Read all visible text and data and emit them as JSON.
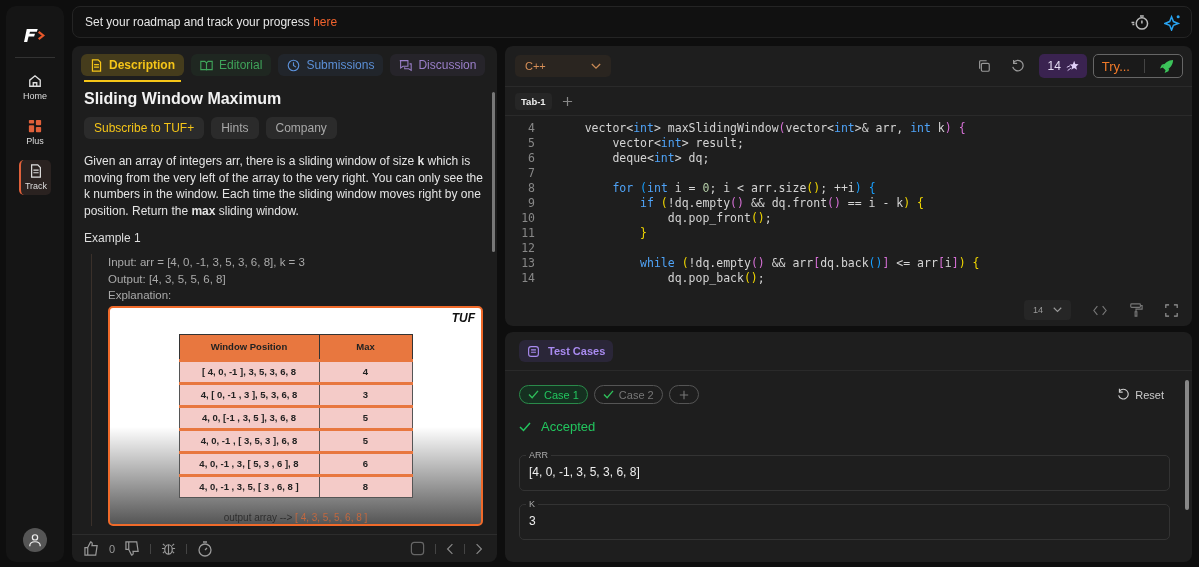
{
  "sidebar": {
    "items": [
      {
        "label": "Home",
        "selected": false
      },
      {
        "label": "Plus",
        "selected": false
      },
      {
        "label": "Track",
        "selected": true
      }
    ]
  },
  "banner": {
    "text": "Set your roadmap and track your progress ",
    "link": "here"
  },
  "problem": {
    "tabs": [
      {
        "label": "Description",
        "color": "#f5c518",
        "selected": true
      },
      {
        "label": "Editorial",
        "color": "#3fa35a",
        "selected": false
      },
      {
        "label": "Submissions",
        "color": "#5b8fd6",
        "selected": false
      },
      {
        "label": "Discussion",
        "color": "#9a7fc9",
        "selected": false
      }
    ],
    "title": "Sliding Window Maximum",
    "chips": [
      {
        "label": "Subscribe to TUF+",
        "kind": "premium"
      },
      {
        "label": "Hints",
        "kind": "plain"
      },
      {
        "label": "Company",
        "kind": "plain"
      }
    ],
    "statement": "Given an array of integers arr, there is a sliding window of size **k** which is moving from the very left of the array to the very right. You can only see the k numbers in the window. Each time the sliding window moves right by one position. Return the **max** sliding window.",
    "example_title": "Example 1",
    "example_lines": [
      "Input: arr = [4, 0, -1, 3, 5, 3, 6, 8], k = 3",
      "Output: [4, 3, 5, 5, 6, 8]",
      "Explanation:"
    ],
    "figure": {
      "logo": "TUF",
      "columns": [
        "Window Position",
        "Max"
      ],
      "rows": [
        [
          "[ 4, 0, -1 ], 3, 5, 3, 6, 8",
          "4"
        ],
        [
          "4, [ 0, -1 , 3 ], 5, 3, 6, 8",
          "3"
        ],
        [
          "4, 0, [-1 , 3, 5 ], 3, 6, 8",
          "5"
        ],
        [
          "4, 0, -1 , [ 3, 5, 3 ], 6, 8",
          "5"
        ],
        [
          "4, 0, -1 , 3, [ 5, 3 , 6 ], 8",
          "6"
        ],
        [
          "4, 0, -1 , 3, 5, [ 3 , 6, 8 ]",
          "8"
        ]
      ],
      "caption": "output array -->",
      "caption_value": "[ 4, 3, 5, 5, 6, 8 ]"
    },
    "likes": "0"
  },
  "editor": {
    "language": "C++",
    "streak": "14",
    "try_label": "Try...",
    "file_tabs": [
      {
        "label": "Tab-1",
        "selected": true
      }
    ],
    "lines": [
      {
        "num": "4",
        "tokens": [
          {
            "kind": "plain",
            "text": "    vector<"
          },
          {
            "kind": "type",
            "text": "int"
          },
          {
            "kind": "plain",
            "text": "> maxSlidingWindow"
          },
          {
            "kind": "b2",
            "text": "("
          },
          {
            "kind": "plain",
            "text": "vector<"
          },
          {
            "kind": "type",
            "text": "int"
          },
          {
            "kind": "plain",
            "text": ">& arr, "
          },
          {
            "kind": "type",
            "text": "int"
          },
          {
            "kind": "plain",
            "text": " k"
          },
          {
            "kind": "b2",
            "text": ")"
          },
          {
            "kind": "b2",
            "text": " {"
          }
        ]
      },
      {
        "num": "5",
        "tokens": [
          {
            "kind": "plain",
            "text": "        vector<"
          },
          {
            "kind": "type",
            "text": "int"
          },
          {
            "kind": "plain",
            "text": "> result;"
          }
        ]
      },
      {
        "num": "6",
        "tokens": [
          {
            "kind": "plain",
            "text": "        deque<"
          },
          {
            "kind": "type",
            "text": "int"
          },
          {
            "kind": "plain",
            "text": "> dq;"
          }
        ]
      },
      {
        "num": "7"
      },
      {
        "num": "8",
        "tokens": [
          {
            "kind": "kw",
            "text": "        for"
          },
          {
            "kind": "b3",
            "text": " ("
          },
          {
            "kind": "kw",
            "text": "int"
          },
          {
            "kind": "plain",
            "text": " i = "
          },
          {
            "kind": "num",
            "text": "0"
          },
          {
            "kind": "plain",
            "text": "; i < arr.size"
          },
          {
            "kind": "b1",
            "text": "()"
          },
          {
            "kind": "plain",
            "text": "; ++i"
          },
          {
            "kind": "b3",
            "text": ")"
          },
          {
            "kind": "b3",
            "text": " {"
          }
        ]
      },
      {
        "num": "9",
        "tokens": [
          {
            "kind": "kw",
            "text": "            if"
          },
          {
            "kind": "b1",
            "text": " ("
          },
          {
            "kind": "plain",
            "text": "!dq.empty"
          },
          {
            "kind": "b2",
            "text": "()"
          },
          {
            "kind": "plain",
            "text": " && dq.front"
          },
          {
            "kind": "b2",
            "text": "()"
          },
          {
            "kind": "plain",
            "text": " == i - k"
          },
          {
            "kind": "b1",
            "text": ")"
          },
          {
            "kind": "b1",
            "text": " {"
          }
        ]
      },
      {
        "num": "10",
        "tokens": [
          {
            "kind": "plain",
            "text": "                dq.pop_front"
          },
          {
            "kind": "b1",
            "text": "()"
          },
          {
            "kind": "plain",
            "text": ";"
          }
        ]
      },
      {
        "num": "11",
        "tokens": [
          {
            "kind": "b1",
            "text": "            }"
          }
        ]
      },
      {
        "num": "12"
      },
      {
        "num": "13",
        "tokens": [
          {
            "kind": "kw",
            "text": "            while"
          },
          {
            "kind": "b1",
            "text": " ("
          },
          {
            "kind": "plain",
            "text": "!dq.empty"
          },
          {
            "kind": "b2",
            "text": "()"
          },
          {
            "kind": "plain",
            "text": " && arr"
          },
          {
            "kind": "b2",
            "text": "["
          },
          {
            "kind": "plain",
            "text": "dq.back"
          },
          {
            "kind": "b3",
            "text": "()"
          },
          {
            "kind": "b2",
            "text": "]"
          },
          {
            "kind": "plain",
            "text": " <= arr"
          },
          {
            "kind": "b2",
            "text": "["
          },
          {
            "kind": "plain",
            "text": "i"
          },
          {
            "kind": "b2",
            "text": "]"
          },
          {
            "kind": "b1",
            "text": ")"
          },
          {
            "kind": "b1",
            "text": " {"
          }
        ]
      },
      {
        "num": "14",
        "tokens": [
          {
            "kind": "plain",
            "text": "                dq.pop_back"
          },
          {
            "kind": "b1",
            "text": "()"
          },
          {
            "kind": "plain",
            "text": ";"
          }
        ]
      }
    ],
    "font_size": "14"
  },
  "tests": {
    "title": "Test Cases",
    "cases": [
      {
        "label": "Case 1",
        "selected": true
      },
      {
        "label": "Case 2",
        "selected": false
      }
    ],
    "reset": "Reset",
    "status": "Accepted",
    "fields": [
      {
        "label": "ARR",
        "value": "[4, 0, -1, 3, 5, 3, 6, 8]"
      },
      {
        "label": "K",
        "value": "3"
      }
    ]
  }
}
